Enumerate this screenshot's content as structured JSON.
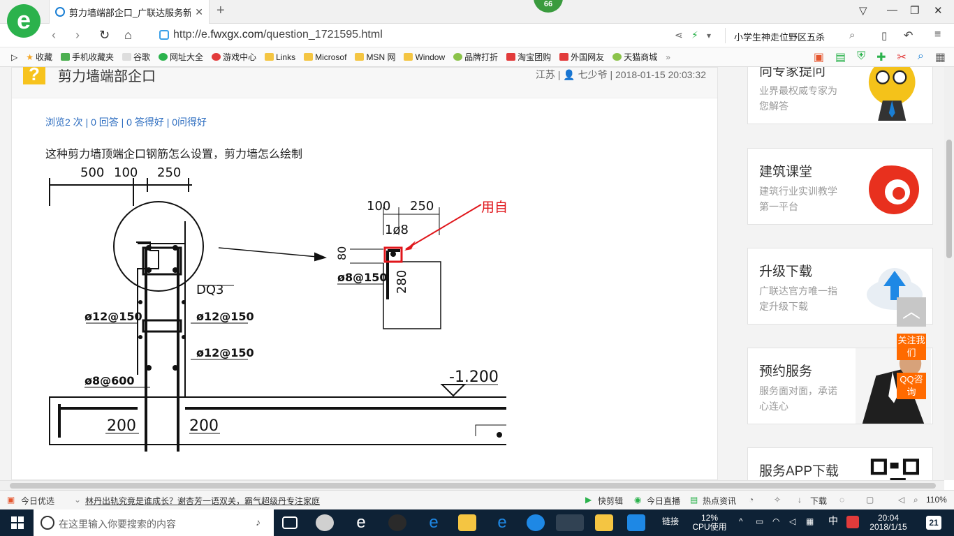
{
  "browser": {
    "tab_title": "剪力墙端部企口_广联达服务新干线",
    "tab_close": "✕",
    "new_tab": "+",
    "notification_count": "66",
    "url_prefix": "http://e.",
    "url_host": "fwxgx.com",
    "url_path": "/question_1721595.html",
    "search_text": "小学生神走位野区五杀",
    "window_controls": [
      "▽",
      "—",
      "❐",
      "✕"
    ]
  },
  "bookmarks": [
    "收藏",
    "手机收藏夹",
    "谷歌",
    "网址大全",
    "游戏中心",
    "Links",
    "Microsof",
    "MSN 网",
    "Window",
    "品牌打折",
    "淘宝团购",
    "外国网友",
    "天猫商城"
  ],
  "question": {
    "icon": "?",
    "title": "剪力墙端部企口",
    "meta": "江苏 | 👤 七少爷 | 2018-01-15 20:03:32",
    "stats": "浏览2 次 | 0 回答 | 0 答得好 | 0问得好",
    "body": "这种剪力墙顶端企口钢筋怎么设置，剪力墙怎么绘制"
  },
  "drawing": {
    "dim_top": [
      "500",
      "100",
      "250"
    ],
    "dim_detail": [
      "100",
      "250"
    ],
    "rebar_1": "1ø8",
    "dim_80": "80",
    "dim_280": "280",
    "rebar_detail": "ø8@150",
    "wall_tag": "DQ3",
    "rebar_left": "ø12@150",
    "rebar_right_1": "ø12@150",
    "rebar_right_2": "ø12@150",
    "rebar_tie": "ø8@600",
    "elevation": "-1.200",
    "dim_bottom": [
      "200",
      "200"
    ],
    "annotation": "用自定义线定义"
  },
  "sidebar": [
    {
      "title": "向专家提问",
      "desc": "业界最权威专家为您解答"
    },
    {
      "title": "建筑课堂",
      "desc": "建筑行业实训教学第一平台"
    },
    {
      "title": "升级下载",
      "desc": "广联达官方唯一指定升级下载"
    },
    {
      "title": "预约服务",
      "desc": "服务面对面，承诺心连心"
    },
    {
      "title": "服务APP下载",
      "desc": ""
    }
  ],
  "float": {
    "to_top": "︿",
    "follow": "关注我们",
    "qq": "QQ咨询"
  },
  "statusbar": {
    "today_pick": "今日优选",
    "news": "林丹出轨究竟是谁成长？谢杏芳一语双关，霸气超级丹专注家庭",
    "quick_edit": "快剪辑",
    "live": "今日直播",
    "hot_news": "热点资讯",
    "download": "下载",
    "zoom": "110%"
  },
  "taskbar": {
    "search_placeholder": "在这里输入你要搜索的内容",
    "links_label": "链接",
    "cpu_percent": "12%",
    "cpu_label": "CPU使用",
    "ime": "中",
    "time": "20:04",
    "date": "2018/1/15",
    "notifications": "21"
  }
}
